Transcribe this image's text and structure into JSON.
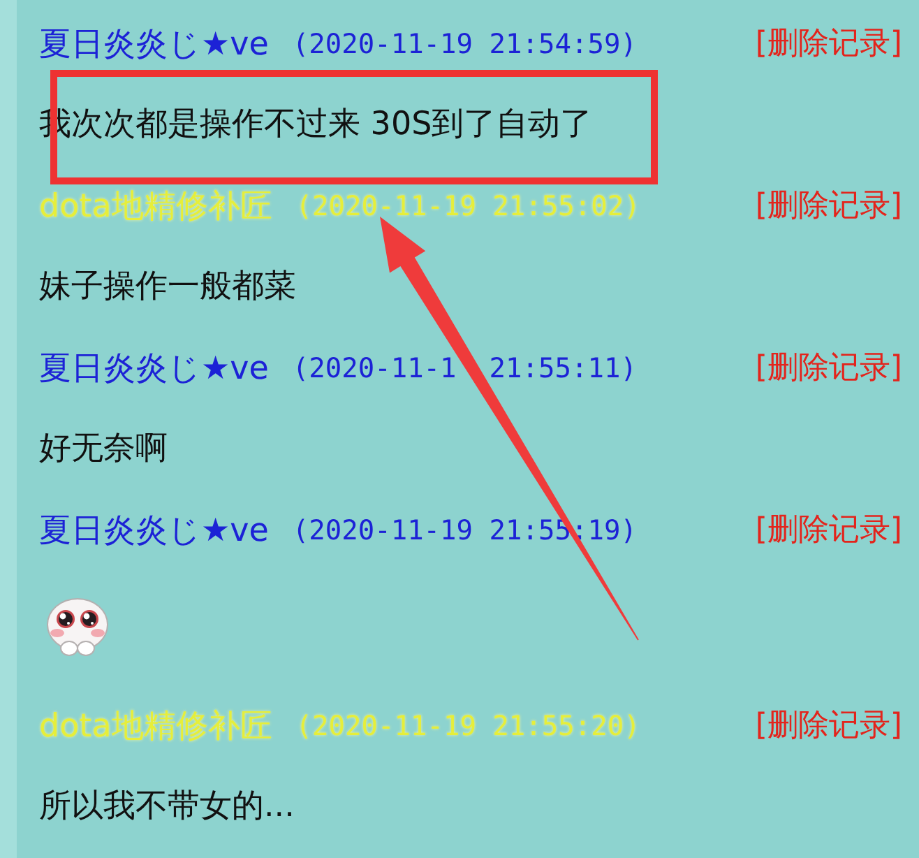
{
  "messages": [
    {
      "author": "夏日炎炎じ★ve",
      "color": "#1c22d6",
      "timestamp": "(2020-11-19 21:54:59)",
      "action": "[删除记录]",
      "body": {
        "kind": "text",
        "text": "我次次都是操作不过来 30S到了自动了"
      }
    },
    {
      "author": "dota地精修补匠",
      "color": "#e6ee3a",
      "timestamp": "(2020-11-19 21:55:02)",
      "action": "[删除记录]",
      "body": {
        "kind": "text",
        "text": "妹子操作一般都菜"
      }
    },
    {
      "author": "夏日炎炎じ★ve",
      "color": "#1c22d6",
      "timestamp": "(2020-11-1  21:55:11)",
      "action": "[删除记录]",
      "body": {
        "kind": "text",
        "text": "好无奈啊"
      }
    },
    {
      "author": "夏日炎炎じ★ve",
      "color": "#1c22d6",
      "timestamp": "(2020-11-19 21:55:19)",
      "action": "[删除记录]",
      "body": {
        "kind": "sticker"
      }
    },
    {
      "author": "dota地精修补匠",
      "color": "#e6ee3a",
      "timestamp": "(2020-11-19 21:55:20)",
      "action": "[删除记录]",
      "body": {
        "kind": "text",
        "text": "所以我不带女的..."
      }
    }
  ]
}
